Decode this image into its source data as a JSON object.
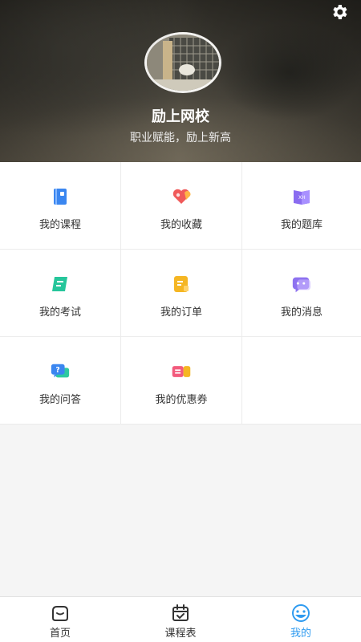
{
  "header": {
    "title": "励上网校",
    "subtitle": "职业赋能，励上新高",
    "settings_icon": "gear-icon",
    "avatar": "avatar-photo"
  },
  "menu": {
    "items": [
      {
        "label": "我的课程",
        "icon": "book-icon",
        "color": "#3a86f0"
      },
      {
        "label": "我的收藏",
        "icon": "heart-icon",
        "color": "#f05a5a"
      },
      {
        "label": "我的题库",
        "icon": "question-bank-icon",
        "color": "#8a6cf0"
      },
      {
        "label": "我的考试",
        "icon": "exam-icon",
        "color": "#26c69b"
      },
      {
        "label": "我的订单",
        "icon": "order-icon",
        "color": "#f5b623"
      },
      {
        "label": "我的消息",
        "icon": "message-icon",
        "color": "#8e72f0"
      },
      {
        "label": "我的问答",
        "icon": "qa-icon",
        "color": "#3a86f0"
      },
      {
        "label": "我的优惠券",
        "icon": "coupon-icon",
        "color": "#f25b7d"
      }
    ]
  },
  "tabbar": {
    "tabs": [
      {
        "label": "首页",
        "icon": "home-icon"
      },
      {
        "label": "课程表",
        "icon": "calendar-icon"
      },
      {
        "label": "我的",
        "icon": "profile-icon",
        "active": true
      }
    ],
    "active_color": "#2f9bf0"
  }
}
